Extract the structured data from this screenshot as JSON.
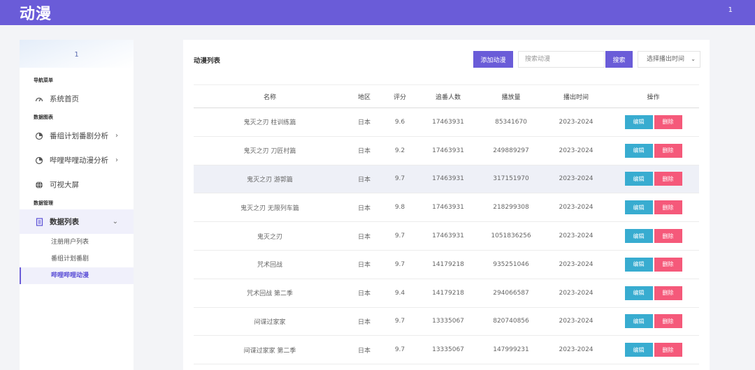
{
  "app": {
    "logo": "动漫",
    "user": "1"
  },
  "sidebar": {
    "user": "1",
    "sections": {
      "nav": "导航菜单",
      "charts": "数据图表",
      "manage": "数据管理"
    },
    "items": {
      "home": "系统首页",
      "fanju": "番组计划番剧分析",
      "bili": "哔哩哔哩动漫分析",
      "screen": "可视大屏",
      "datalist": "数据列表"
    },
    "sub": {
      "users": "注册用户列表",
      "fanzu": "番组计划番剧",
      "bilibili": "哔哩哔哩动漫"
    }
  },
  "toolbar": {
    "title": "动漫列表",
    "add_label": "添加动漫",
    "search_placeholder": "搜索动漫",
    "search_label": "搜索",
    "select_label": "选择播出时间"
  },
  "table": {
    "headers": {
      "name": "名称",
      "region": "地区",
      "score": "评分",
      "followers": "追番人数",
      "plays": "播放量",
      "time": "播出时间",
      "ops": "操作"
    },
    "edit_label": "编辑",
    "delete_label": "删除",
    "rows": [
      {
        "name": "鬼灭之刃 柱训练篇",
        "region": "日本",
        "score": "9.6",
        "followers": "17463931",
        "plays": "85341670",
        "time": "2023-2024"
      },
      {
        "name": "鬼灭之刃 刀匠村篇",
        "region": "日本",
        "score": "9.2",
        "followers": "17463931",
        "plays": "249889297",
        "time": "2023-2024"
      },
      {
        "name": "鬼灭之刃 游郭篇",
        "region": "日本",
        "score": "9.7",
        "followers": "17463931",
        "plays": "317151970",
        "time": "2023-2024"
      },
      {
        "name": "鬼灭之刃 无限列车篇",
        "region": "日本",
        "score": "9.8",
        "followers": "17463931",
        "plays": "218299308",
        "time": "2023-2024"
      },
      {
        "name": "鬼灭之刃",
        "region": "日本",
        "score": "9.7",
        "followers": "17463931",
        "plays": "1051836256",
        "time": "2023-2024"
      },
      {
        "name": "咒术回战",
        "region": "日本",
        "score": "9.7",
        "followers": "14179218",
        "plays": "935251046",
        "time": "2023-2024"
      },
      {
        "name": "咒术回战 第二季",
        "region": "日本",
        "score": "9.4",
        "followers": "14179218",
        "plays": "294066587",
        "time": "2023-2024"
      },
      {
        "name": "间谍过家家",
        "region": "日本",
        "score": "9.7",
        "followers": "13335067",
        "plays": "820740856",
        "time": "2023-2024"
      },
      {
        "name": "间谍过家家 第二季",
        "region": "日本",
        "score": "9.7",
        "followers": "13335067",
        "plays": "147999231",
        "time": "2023-2024"
      }
    ]
  }
}
